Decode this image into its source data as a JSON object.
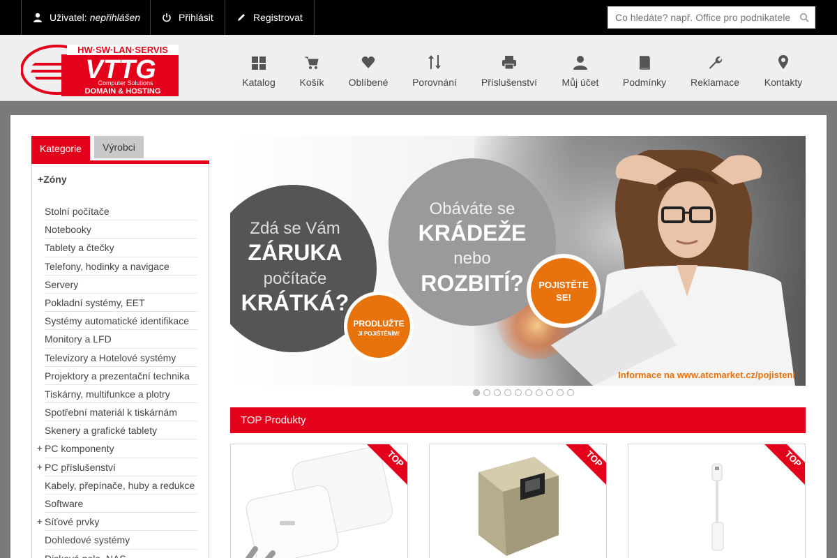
{
  "topbar": {
    "user_label": "Uživatel:",
    "user_status": "nepřihlášen",
    "login": "Přihlásit",
    "register": "Registrovat",
    "search_placeholder": "Co hledáte? např. Office pro podnikatele"
  },
  "logo": {
    "top_line": "HW·SW·LAN·SERVIS",
    "name": "VTTG",
    "tagline": "Computer Solutions",
    "bottom_line": "DOMAIN & HOSTING"
  },
  "nav": [
    {
      "label": "Katalog",
      "icon": "grid-icon"
    },
    {
      "label": "Košík",
      "icon": "cart-icon"
    },
    {
      "label": "Oblíbené",
      "icon": "heart-icon"
    },
    {
      "label": "Porovnání",
      "icon": "sort-arrows-icon"
    },
    {
      "label": "Příslušenství",
      "icon": "printer-icon"
    },
    {
      "label": "Můj účet",
      "icon": "user-icon"
    },
    {
      "label": "Podmínky",
      "icon": "book-icon"
    },
    {
      "label": "Reklamace",
      "icon": "wrench-icon"
    },
    {
      "label": "Kontakty",
      "icon": "map-marker-icon"
    }
  ],
  "sidebar": {
    "tabs": [
      "Kategorie",
      "Výrobci"
    ],
    "active_tab": "Kategorie",
    "heading": "Zóny",
    "categories": [
      {
        "label": "Stolní počítače",
        "expandable": false
      },
      {
        "label": "Notebooky",
        "expandable": false
      },
      {
        "label": "Tablety a čtečky",
        "expandable": false
      },
      {
        "label": "Telefony, hodinky a navigace",
        "expandable": false
      },
      {
        "label": "Servery",
        "expandable": false
      },
      {
        "label": "Pokladní systémy, EET",
        "expandable": false
      },
      {
        "label": "Systémy automatické identifikace",
        "expandable": false
      },
      {
        "label": "Monitory a LFD",
        "expandable": false
      },
      {
        "label": "Televizory a Hotelové systémy",
        "expandable": false
      },
      {
        "label": "Projektory a prezentační technika",
        "expandable": false
      },
      {
        "label": "Tiskárny, multifunkce a plotry",
        "expandable": false
      },
      {
        "label": "Spotřební materiál k tiskárnám",
        "expandable": false
      },
      {
        "label": "Skenery a grafické tablety",
        "expandable": false
      },
      {
        "label": "PC komponenty",
        "expandable": true
      },
      {
        "label": "PC příslušenství",
        "expandable": true
      },
      {
        "label": "Kabely, přepínače, huby a redukce",
        "expandable": false
      },
      {
        "label": "Software",
        "expandable": false
      },
      {
        "label": "Síťové prvky",
        "expandable": true
      },
      {
        "label": "Dohledové systémy",
        "expandable": false
      },
      {
        "label": "Disková pole, NAS",
        "expandable": false
      }
    ]
  },
  "banner": {
    "left_circle": [
      "Zdá se Vám",
      "ZÁRUKA",
      "počítače",
      "KRÁTKÁ?"
    ],
    "left_badge": [
      "PRODLUŽTE",
      "JI POJIŠTĚNÍM!"
    ],
    "right_circle": [
      "Obáváte se",
      "KRÁDEŽE",
      "nebo",
      "ROZBITÍ?"
    ],
    "right_badge": [
      "POJISTĚTE",
      "SE!"
    ],
    "info": "Informace na www.atcmarket.cz/pojisteni",
    "slide_count": 10,
    "active_slide": 0
  },
  "top_products": {
    "heading": "TOP Produkty",
    "ribbon": "TOP",
    "items": [
      {
        "kind": "charger"
      },
      {
        "kind": "rj45-coupler"
      },
      {
        "kind": "usb-c-adapter"
      }
    ]
  },
  "colors": {
    "accent": "#e3001b",
    "orange": "#e8730c",
    "dark_gray": "#555555",
    "mid_gray": "#9a9a9a"
  }
}
